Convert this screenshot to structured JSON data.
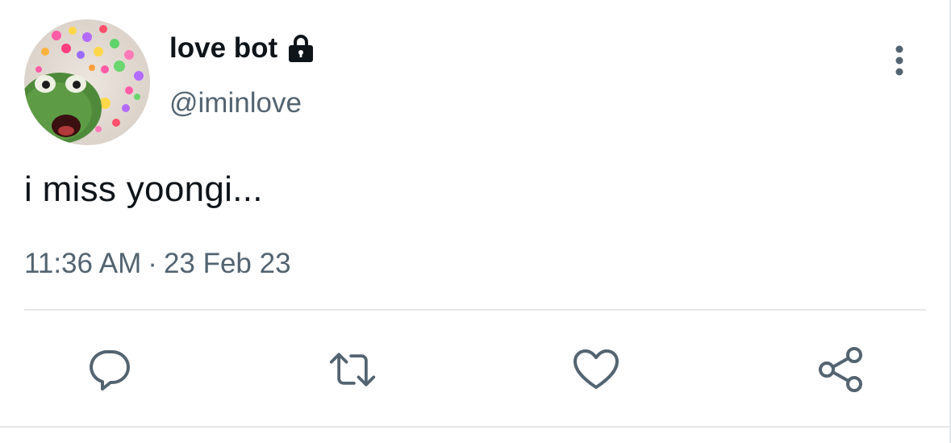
{
  "tweet": {
    "display_name": "love bot",
    "handle": "@iminlove",
    "text": "i miss yoongi...",
    "time": "11:36 AM",
    "separator": "·",
    "date": "23 Feb 23",
    "protected": true
  },
  "icons": {
    "lock": "lock-icon",
    "more": "more-vertical-icon",
    "reply": "reply-icon",
    "retweet": "retweet-icon",
    "like": "heart-icon",
    "share": "share-icon"
  },
  "colors": {
    "text": "#0f1419",
    "secondary": "#536471",
    "divider": "#e6e8ea",
    "icon": "#536471"
  }
}
